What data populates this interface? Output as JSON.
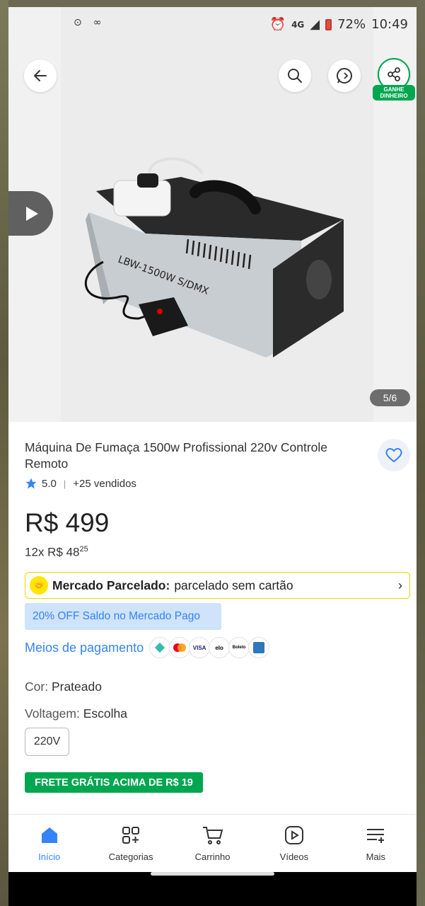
{
  "status_bar": {
    "network": "4G",
    "battery": "72%",
    "time": "10:49"
  },
  "gallery": {
    "counter": "5/6",
    "badge": "GANHE DINHEIRO",
    "photo_text": "LBW-1500W S/DMX"
  },
  "product": {
    "title": "Máquina De Fumaça 1500w Profissional 220v Controle Remoto",
    "rating": "5.0",
    "sold": "+25 vendidos",
    "price": "R$ 499",
    "installments_prefix": "12x R$ 48",
    "installments_cents": "25"
  },
  "parcelado": {
    "label": "Mercado Parcelado:",
    "text": "parcelado sem cartão"
  },
  "discount": "20% OFF Saldo no Mercado Pago",
  "payment": {
    "link": "Meios de pagamento",
    "icons": [
      "pix-icon",
      "mastercard-icon",
      "visa-icon",
      "elo-icon",
      "boleto-icon",
      "amex-icon"
    ],
    "visa_label": "VISA",
    "elo_label": "elo",
    "boleto_label": "Boleto"
  },
  "attributes": {
    "color_label": "Cor:",
    "color_value": "Prateado",
    "voltage_label": "Voltagem:",
    "voltage_value": "Escolha",
    "voltage_option": "220V"
  },
  "frete": "FRETE GRÁTIS ACIMA DE R$ 19",
  "bottom_nav": {
    "inicio": "Início",
    "categorias": "Categorias",
    "carrinho": "Carrinho",
    "videos": "Vídeos",
    "mais": "Mais"
  },
  "colors": {
    "accent_blue": "#3483fa",
    "green": "#00a650",
    "yellow": "#ffe600"
  }
}
